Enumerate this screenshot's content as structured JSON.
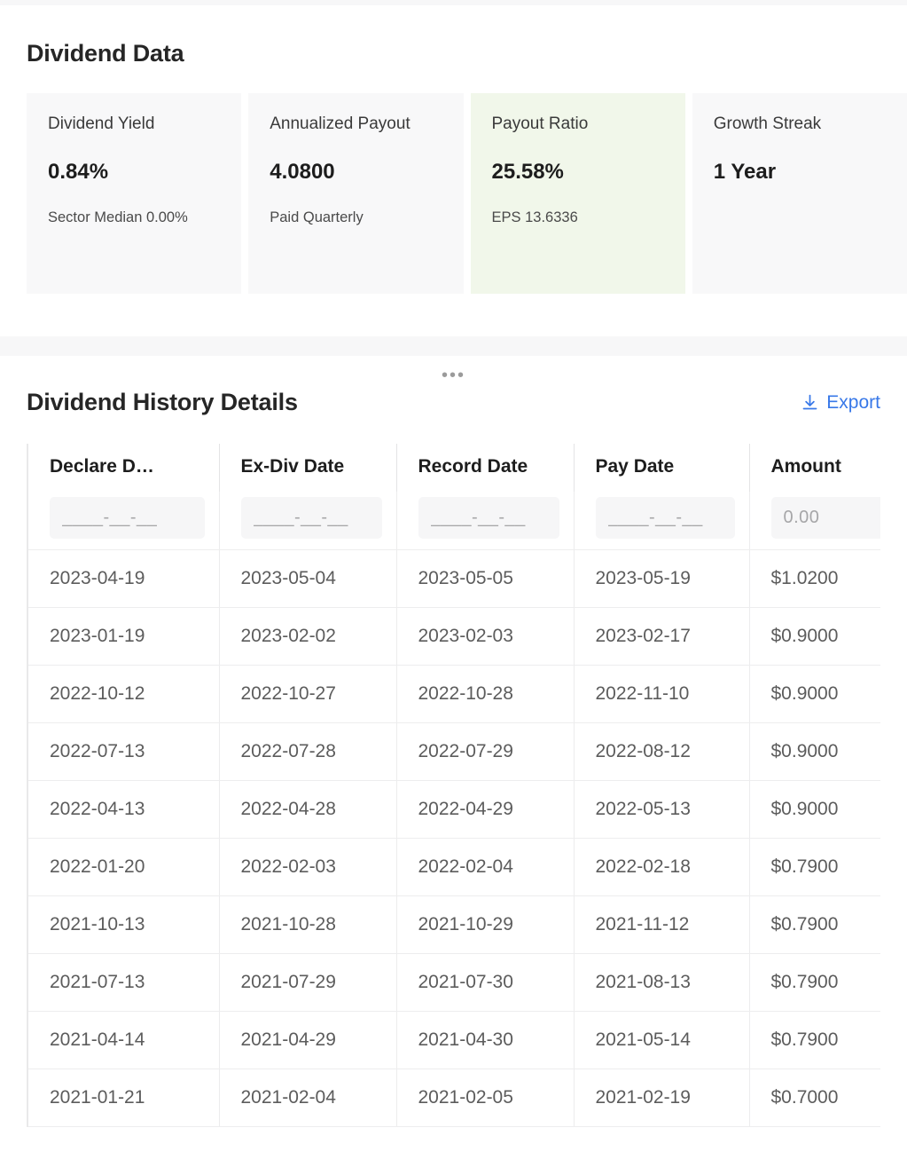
{
  "dividend_data": {
    "title": "Dividend Data",
    "cards": [
      {
        "label": "Dividend Yield",
        "value": "0.84%",
        "sub": "Sector Median 0.00%",
        "highlight": false
      },
      {
        "label": "Annualized Payout",
        "value": "4.0800",
        "sub": "Paid Quarterly",
        "highlight": false
      },
      {
        "label": "Payout Ratio",
        "value": "25.58%",
        "sub": "EPS 13.6336",
        "highlight": true
      },
      {
        "label": "Growth Streak",
        "value": "1 Year",
        "sub": "",
        "highlight": false
      }
    ],
    "highlight_color": "#f1f7ea",
    "card_bg_color": "#f8f8f9"
  },
  "history": {
    "title": "Dividend History Details",
    "drag_handle": "•••",
    "export_label": "Export",
    "export_icon": "download-icon",
    "export_color": "#3878e8",
    "columns": [
      "Declare D…",
      "Ex-Div Date",
      "Record Date",
      "Pay Date",
      "Amount"
    ],
    "filters": [
      {
        "name": "declare-date-filter",
        "placeholder": "____-__-__",
        "value": ""
      },
      {
        "name": "ex-div-date-filter",
        "placeholder": "____-__-__",
        "value": ""
      },
      {
        "name": "record-date-filter",
        "placeholder": "____-__-__",
        "value": ""
      },
      {
        "name": "pay-date-filter",
        "placeholder": "____-__-__",
        "value": ""
      },
      {
        "name": "amount-filter",
        "placeholder": "0.00",
        "value": ""
      }
    ],
    "rows": [
      {
        "declare_date": "2023-04-19",
        "ex_div_date": "2023-05-04",
        "record_date": "2023-05-05",
        "pay_date": "2023-05-19",
        "amount": "$1.0200"
      },
      {
        "declare_date": "2023-01-19",
        "ex_div_date": "2023-02-02",
        "record_date": "2023-02-03",
        "pay_date": "2023-02-17",
        "amount": "$0.9000"
      },
      {
        "declare_date": "2022-10-12",
        "ex_div_date": "2022-10-27",
        "record_date": "2022-10-28",
        "pay_date": "2022-11-10",
        "amount": "$0.9000"
      },
      {
        "declare_date": "2022-07-13",
        "ex_div_date": "2022-07-28",
        "record_date": "2022-07-29",
        "pay_date": "2022-08-12",
        "amount": "$0.9000"
      },
      {
        "declare_date": "2022-04-13",
        "ex_div_date": "2022-04-28",
        "record_date": "2022-04-29",
        "pay_date": "2022-05-13",
        "amount": "$0.9000"
      },
      {
        "declare_date": "2022-01-20",
        "ex_div_date": "2022-02-03",
        "record_date": "2022-02-04",
        "pay_date": "2022-02-18",
        "amount": "$0.7900"
      },
      {
        "declare_date": "2021-10-13",
        "ex_div_date": "2021-10-28",
        "record_date": "2021-10-29",
        "pay_date": "2021-11-12",
        "amount": "$0.7900"
      },
      {
        "declare_date": "2021-07-13",
        "ex_div_date": "2021-07-29",
        "record_date": "2021-07-30",
        "pay_date": "2021-08-13",
        "amount": "$0.7900"
      },
      {
        "declare_date": "2021-04-14",
        "ex_div_date": "2021-04-29",
        "record_date": "2021-04-30",
        "pay_date": "2021-05-14",
        "amount": "$0.7900"
      },
      {
        "declare_date": "2021-01-21",
        "ex_div_date": "2021-02-04",
        "record_date": "2021-02-05",
        "pay_date": "2021-02-19",
        "amount": "$0.7000"
      }
    ]
  }
}
